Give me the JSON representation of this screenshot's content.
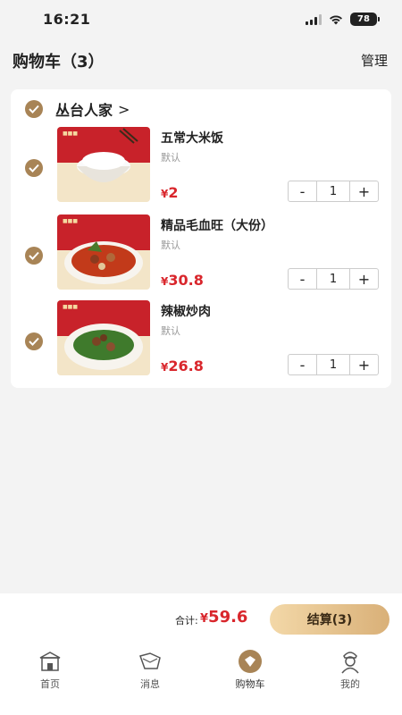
{
  "status": {
    "time": "16:21",
    "battery": "78"
  },
  "header": {
    "title": "购物车（3）",
    "manage": "管理"
  },
  "shop": {
    "name": "丛台人家",
    "arrow": ">"
  },
  "items": [
    {
      "name": "五常大米饭",
      "spec": "默认",
      "currency": "¥",
      "price": "2",
      "qty": "1",
      "minus": "-",
      "plus": "+"
    },
    {
      "name": "精品毛血旺（大份）",
      "spec": "默认",
      "currency": "¥",
      "price": "30.8",
      "qty": "1",
      "minus": "-",
      "plus": "+"
    },
    {
      "name": "辣椒炒肉",
      "spec": "默认",
      "currency": "¥",
      "price": "26.8",
      "qty": "1",
      "minus": "-",
      "plus": "+"
    }
  ],
  "checkout": {
    "total_label": "合计:",
    "currency": "¥",
    "total": "59.6",
    "button": "结算(3)"
  },
  "tabs": [
    {
      "label": "首页",
      "icon": "home-icon"
    },
    {
      "label": "消息",
      "icon": "message-icon"
    },
    {
      "label": "购物车",
      "icon": "cart-icon"
    },
    {
      "label": "我的",
      "icon": "profile-icon"
    }
  ],
  "colors": {
    "accent": "#a88456",
    "price": "#d9262c",
    "button_start": "#f3d8a8",
    "button_end": "#d9b078"
  }
}
